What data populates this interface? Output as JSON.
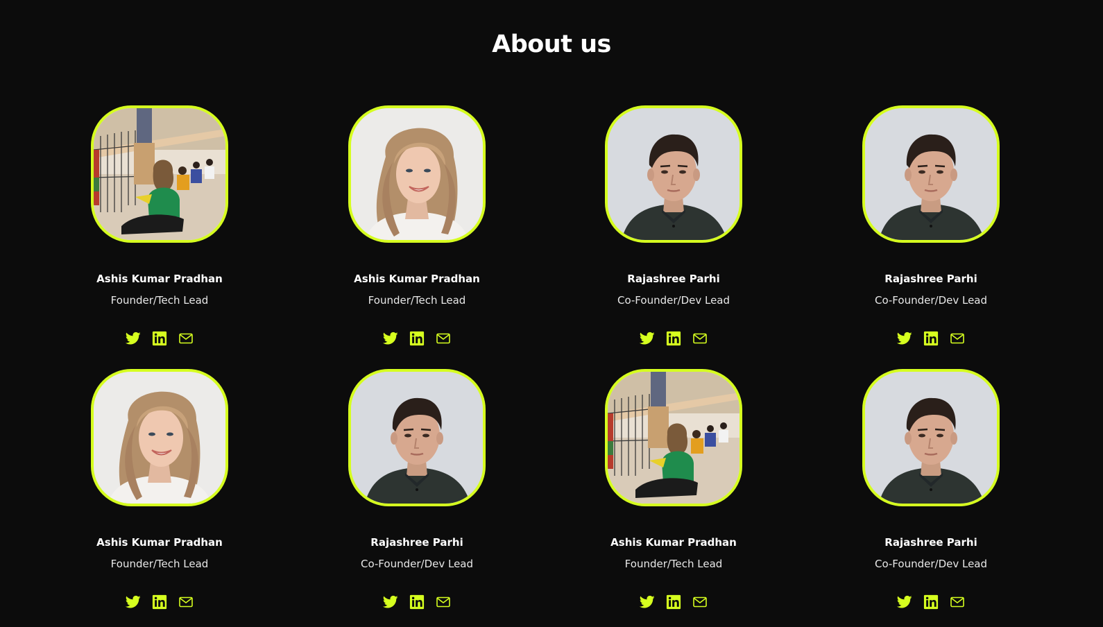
{
  "page": {
    "title": "About us"
  },
  "colors": {
    "background": "#0c0c0c",
    "accent": "#d6ff1f",
    "text": "#ffffff"
  },
  "team": [
    {
      "name": "Ashis Kumar Pradhan",
      "role": "Founder/Tech Lead",
      "photo": "group-photo"
    },
    {
      "name": "Ashis Kumar Pradhan",
      "role": "Founder/Tech Lead",
      "photo": "blonde-woman-photo"
    },
    {
      "name": "Rajashree Parhi",
      "role": "Co-Founder/Dev Lead",
      "photo": "young-man-photo"
    },
    {
      "name": "Rajashree Parhi",
      "role": "Co-Founder/Dev Lead",
      "photo": "young-man-photo"
    },
    {
      "name": "Ashis Kumar Pradhan",
      "role": "Founder/Tech Lead",
      "photo": "blonde-woman-photo"
    },
    {
      "name": "Rajashree Parhi",
      "role": "Co-Founder/Dev Lead",
      "photo": "young-man-photo"
    },
    {
      "name": "Ashis Kumar Pradhan",
      "role": "Founder/Tech Lead",
      "photo": "group-photo"
    },
    {
      "name": "Rajashree Parhi",
      "role": "Co-Founder/Dev Lead",
      "photo": "young-man-photo"
    }
  ],
  "social_icons": [
    "twitter-icon",
    "linkedin-icon",
    "mail-icon"
  ]
}
